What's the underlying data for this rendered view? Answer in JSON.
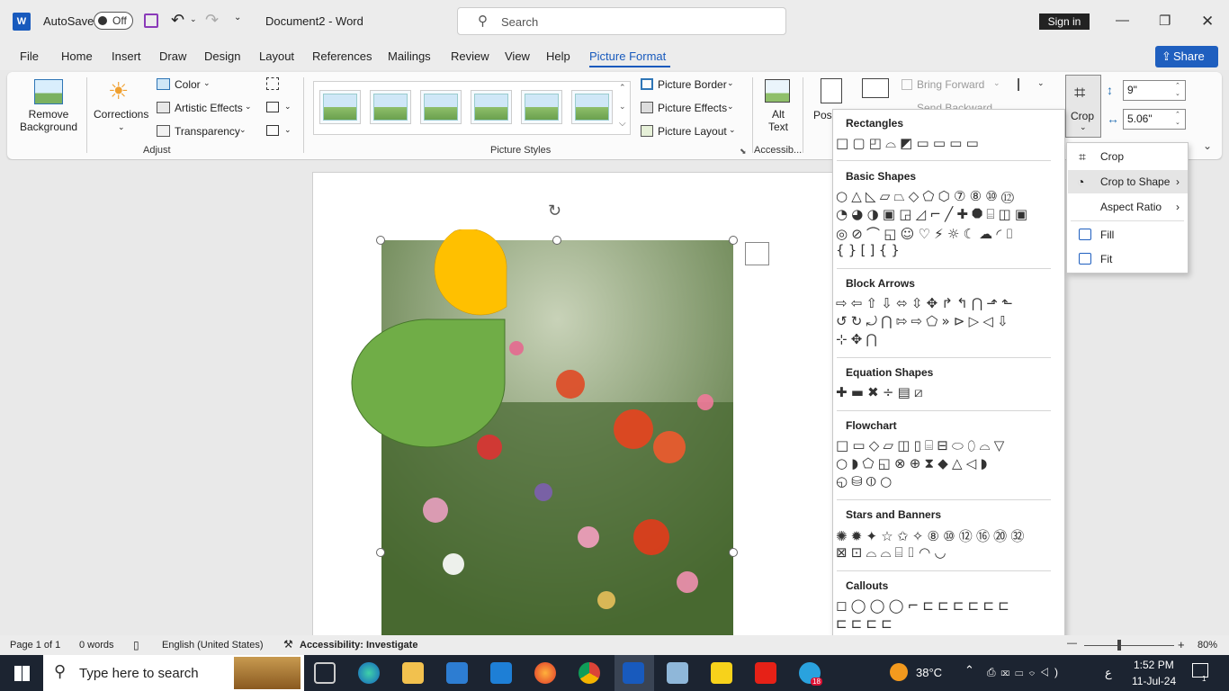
{
  "titlebar": {
    "autosave_label": "AutoSave",
    "autosave_state": "Off",
    "doc_title": "Document2 - Word",
    "search_placeholder": "Search",
    "signin_label": "Sign in"
  },
  "tabs": [
    "File",
    "Home",
    "Insert",
    "Draw",
    "Design",
    "Layout",
    "References",
    "Mailings",
    "Review",
    "View",
    "Help",
    "Picture Format"
  ],
  "active_tab": "Picture Format",
  "share_label": "Share",
  "ribbon": {
    "adjust": {
      "remove_background": "Remove\nBackground",
      "corrections": "Corrections",
      "color": "Color",
      "artistic_effects": "Artistic Effects",
      "transparency": "Transparency",
      "group_label": "Adjust"
    },
    "picture_styles": {
      "picture_border": "Picture Border",
      "picture_effects": "Picture Effects",
      "picture_layout": "Picture Layout",
      "group_label": "Picture Styles"
    },
    "accessibility": {
      "alt_text": "Alt\nText",
      "group_label": "Accessib..."
    },
    "arrange": {
      "position": "Pos",
      "bring_forward": "Bring Forward",
      "send_backward": "Send Backward"
    },
    "size": {
      "crop_label": "Crop",
      "height_value": "9\"",
      "width_value": "5.06\""
    }
  },
  "shapes_panel": {
    "sections": [
      {
        "title": "Rectangles",
        "rows": [
          "□▢◰⌓◩▭▭▭▭"
        ]
      },
      {
        "title": "Basic Shapes",
        "rows": [
          "○△◺▱⏢◇⬠⬡⑦⑧⑩⑫",
          "◔◕◑▣◲◿⌐╱✚⯃⌸◫▣",
          "◎⊘⌒◱☺♡⚡☼☾☁◜⌷",
          "{}[]{}"
        ]
      },
      {
        "title": "Block Arrows",
        "rows": [
          "⇨⇦⇧⇩⬄⇳✥↱↰⋂⬏⬑",
          "↺↻⤾⋂⇰⇨⬠»⊳▷◁⇩",
          "⊹✥⋂"
        ]
      },
      {
        "title": "Equation Shapes",
        "rows": [
          "✚▬✖÷▤⧄"
        ]
      },
      {
        "title": "Flowchart",
        "rows": [
          "□▭◇▱◫▯⌸⊟⬭⬯⌓▽",
          "○◗⬠◱⊗⊕⧗◆△◁◗",
          "◵⛁⦶○"
        ]
      },
      {
        "title": "Stars and Banners",
        "rows": [
          "✺✹✦☆✩✧⑧⑩⑫⑯⑳㉜",
          "⊠⊡⌓⌓⌸⌷◠◡"
        ]
      },
      {
        "title": "Callouts",
        "rows": [
          "◻◯◯◯⌐⊏⊏⊏⊏⊏⊏",
          "⊏⊏⊏⊏"
        ]
      }
    ]
  },
  "crop_menu": {
    "items": [
      {
        "label": "Crop",
        "submenu": false
      },
      {
        "label": "Crop to Shape",
        "submenu": true
      },
      {
        "label": "Aspect Ratio",
        "submenu": true
      },
      {
        "label": "Fill",
        "submenu": false
      },
      {
        "label": "Fit",
        "submenu": false
      }
    ]
  },
  "statusbar": {
    "page": "Page 1 of 1",
    "words": "0 words",
    "language": "English (United States)",
    "accessibility": "Accessibility: Investigate",
    "zoom": "80%"
  },
  "taskbar": {
    "search_placeholder": "Type here to search",
    "temperature": "38°C",
    "time": "1:52 PM",
    "date": "11-Jul-24",
    "ime_char": "ع",
    "notification_count": "1",
    "telegram_badge": "18"
  },
  "colors": {
    "accent": "#185abd",
    "shape_yellow": "#ffc000",
    "shape_green": "#70ad47"
  }
}
